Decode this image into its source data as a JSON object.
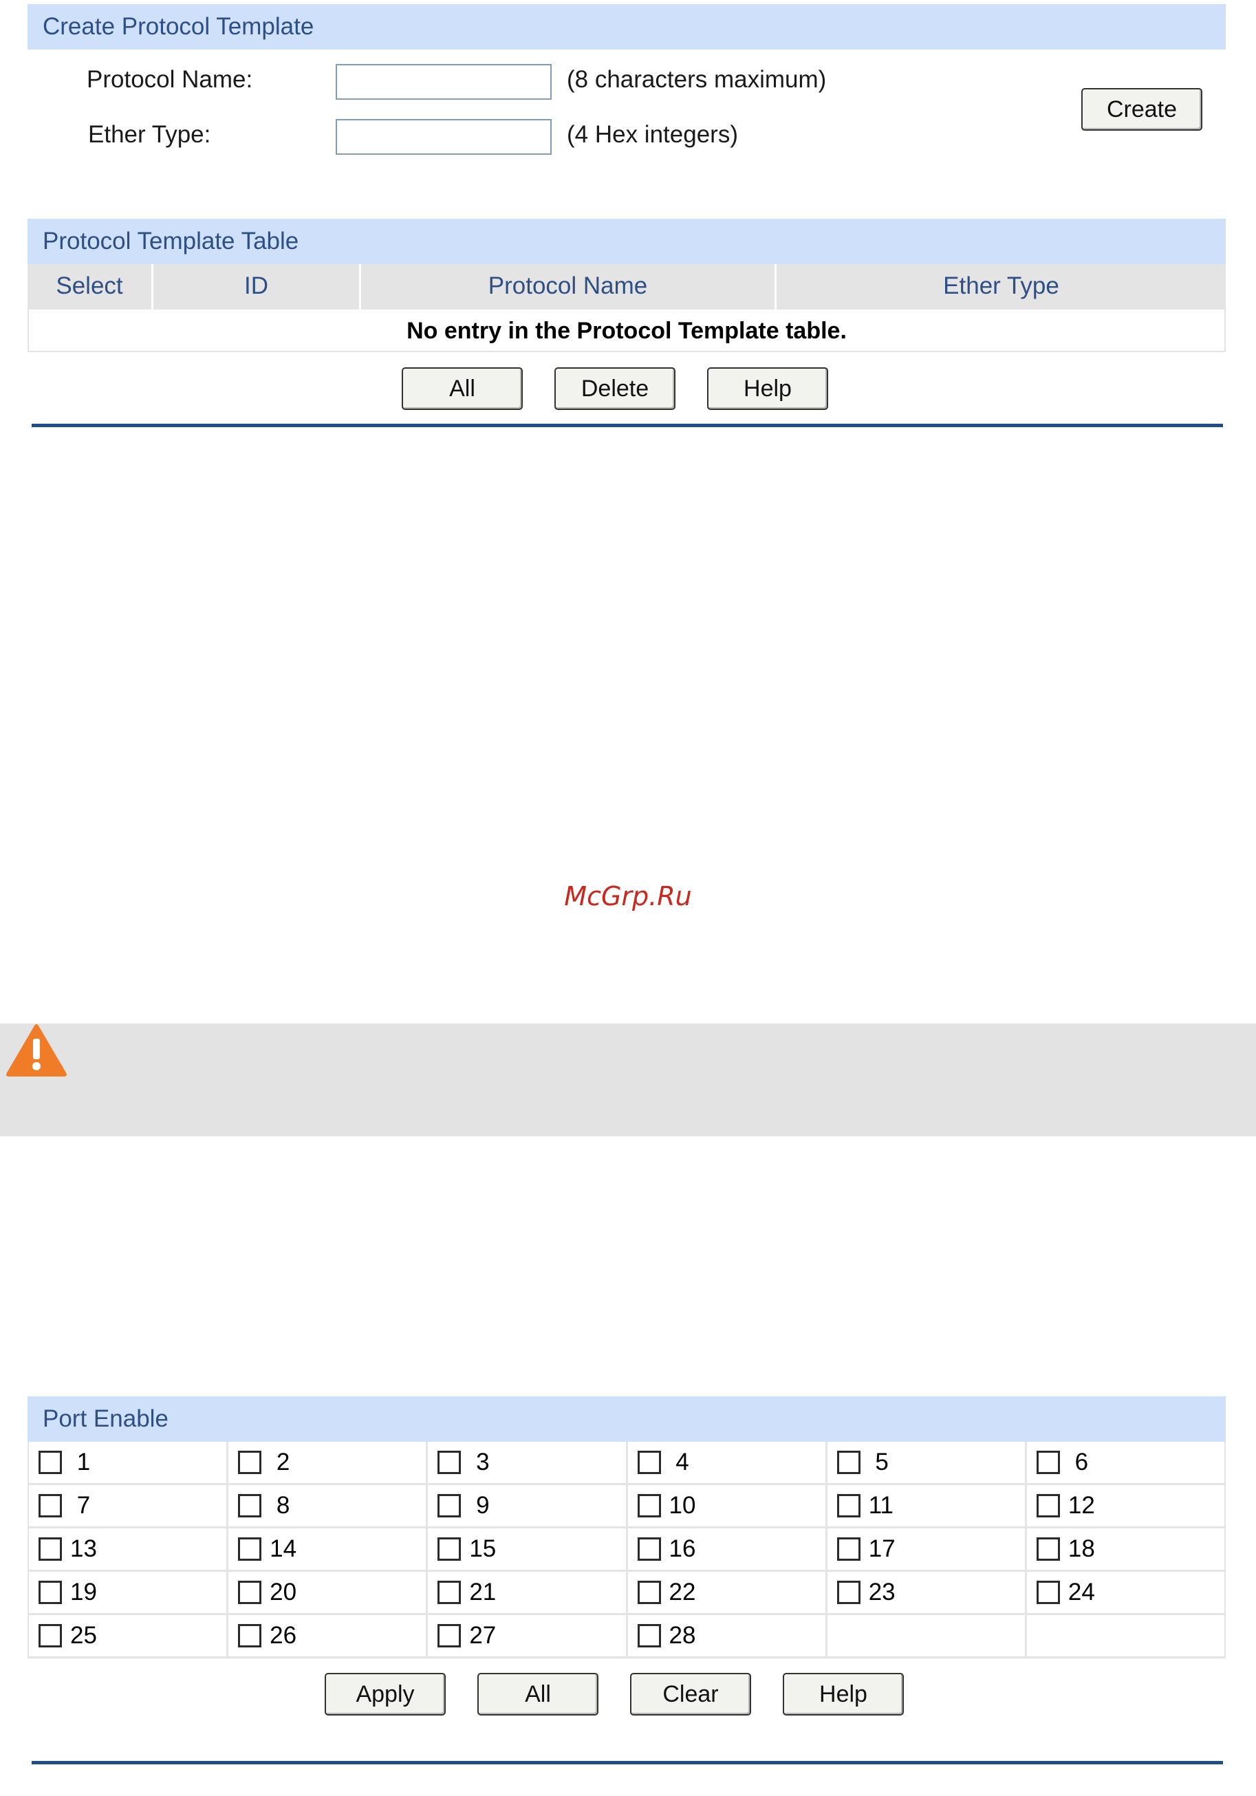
{
  "create_panel": {
    "title": "Create Protocol Template",
    "protocol_name_label": "Protocol Name:",
    "protocol_name_value": "",
    "protocol_name_hint": "(8 characters maximum)",
    "ether_type_label": "Ether Type:",
    "ether_type_value": "",
    "ether_type_hint": "(4 Hex integers)",
    "create_button": "Create"
  },
  "table_panel": {
    "title": "Protocol Template Table",
    "columns": [
      "Select",
      "ID",
      "Protocol Name",
      "Ether Type"
    ],
    "empty_message": "No entry in the Protocol Template table.",
    "buttons": {
      "all": "All",
      "delete": "Delete",
      "help": "Help"
    }
  },
  "watermark": "McGrp.Ru",
  "note": {
    "icon": "warning-icon",
    "icon_color": "#f07c28"
  },
  "port_panel": {
    "title": "Port Enable",
    "ports": [
      [
        " 1",
        " 2",
        " 3",
        " 4",
        " 5",
        " 6"
      ],
      [
        " 7",
        " 8",
        " 9",
        "10",
        "11",
        "12"
      ],
      [
        "13",
        "14",
        "15",
        "16",
        "17",
        "18"
      ],
      [
        "19",
        "20",
        "21",
        "22",
        "23",
        "24"
      ],
      [
        "25",
        "26",
        "27",
        "28",
        "",
        ""
      ]
    ],
    "buttons": {
      "apply": "Apply",
      "all": "All",
      "clear": "Clear",
      "help": "Help"
    }
  },
  "colors": {
    "header_bg": "#cfe0fa",
    "header_text": "#2e4f86",
    "divider": "#1f4f86",
    "watermark": "#c8281e"
  }
}
